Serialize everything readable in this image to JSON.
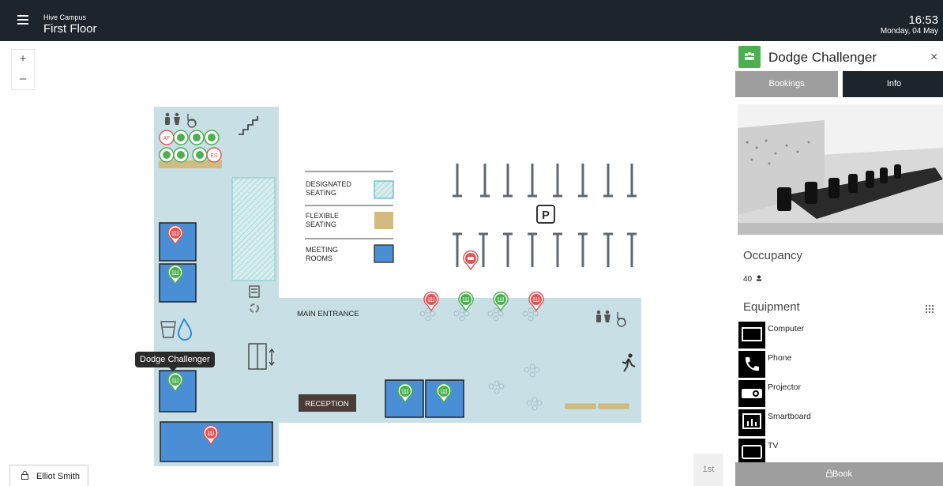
{
  "header": {
    "campus": "Hive Campus",
    "floor": "First Floor",
    "time": "16:53",
    "date": "Monday, 04 May"
  },
  "map": {
    "zoom_in": "+",
    "zoom_out": "–",
    "tooltip": "Dodge Challenger",
    "user_name": "Elliot Smith",
    "level": "1st",
    "legend": {
      "designated_line1": "DESIGNATED",
      "designated_line2": "SEATING",
      "flexible_line1": "FLEXIBLE",
      "flexible_line2": "SEATING",
      "meeting_line1": "MEETING",
      "meeting_line2": "ROOMS"
    },
    "main_entrance": "MAIN ENTRANCE",
    "reception": "RECEPTION",
    "parking_sign": "P",
    "desk_initials": [
      "AF",
      "ES"
    ],
    "colors": {
      "floor": "#c8dfe6",
      "meeting_room": "#4a8ed6",
      "flexible": "#d2bb7e",
      "pin_available": "#4caf50",
      "pin_booked": "#e05555"
    }
  },
  "panel": {
    "title": "Dodge Challenger",
    "close": "×",
    "tabs": {
      "bookings": "Bookings",
      "info": "Info"
    },
    "occupancy_heading": "Occupancy",
    "occupancy_value": "40",
    "equipment_heading": "Equipment",
    "equipment": [
      {
        "label": "Computer",
        "icon": "computer-icon"
      },
      {
        "label": "Phone",
        "icon": "phone-icon"
      },
      {
        "label": "Projector",
        "icon": "projector-icon"
      },
      {
        "label": "Smartboard",
        "icon": "smartboard-icon"
      },
      {
        "label": "TV",
        "icon": "tv-icon"
      }
    ],
    "book_label": "Book"
  }
}
